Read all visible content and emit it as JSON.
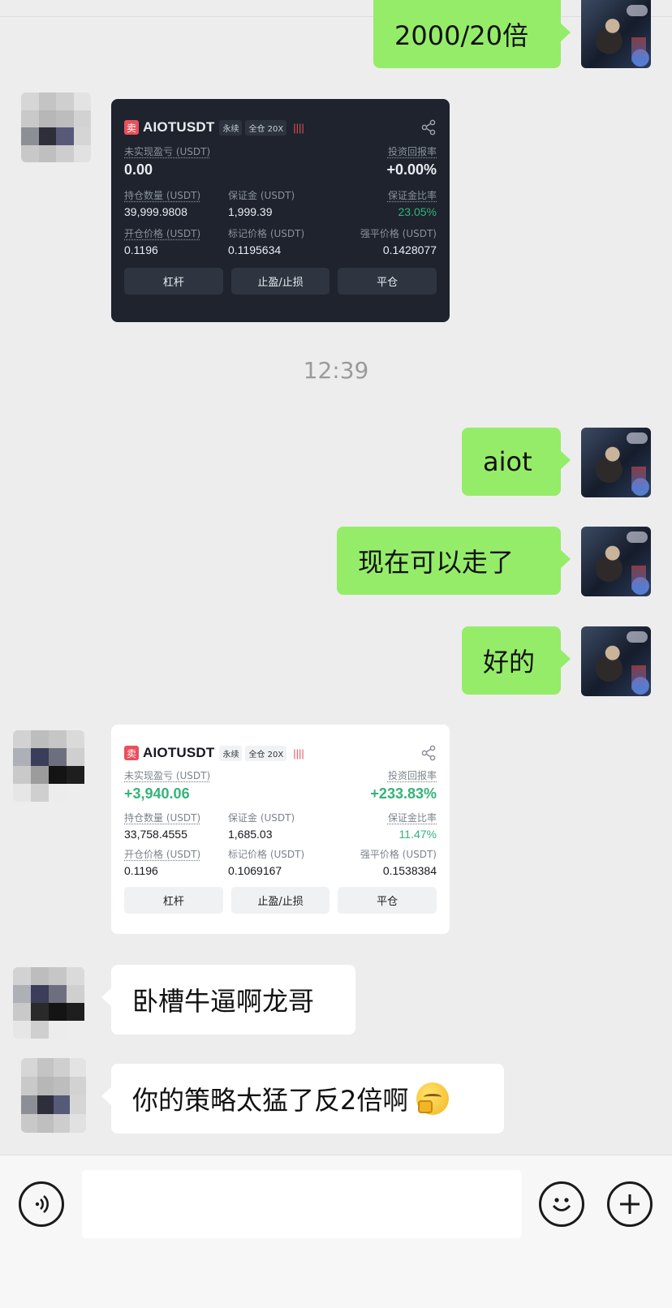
{
  "messages": {
    "m1": "2000/20倍",
    "timestamp": "12:39",
    "m2": "aiot",
    "m3": "现在可以走了",
    "m4": "好的",
    "m5": "卧槽牛逼啊龙哥",
    "m6": "你的策略太猛了反2倍啊"
  },
  "card1": {
    "side_badge": "卖",
    "symbol": "AIOTUSDT",
    "tag_perp": "永续",
    "tag_margin": "全仓 20X",
    "bars": "||||",
    "unrealized_label": "未实现盈亏 (USDT)",
    "unrealized_value": "0.00",
    "roi_label": "投资回报率",
    "roi_value": "+0.00%",
    "size_label": "持仓数量 (USDT)",
    "size_value": "39,999.9808",
    "margin_label": "保证金 (USDT)",
    "margin_value": "1,999.39",
    "margin_ratio_label": "保证金比率",
    "margin_ratio_value": "23.05%",
    "entry_label": "开仓价格 (USDT)",
    "entry_value": "0.1196",
    "mark_label": "标记价格 (USDT)",
    "mark_value": "0.1195634",
    "liq_label": "强平价格 (USDT)",
    "liq_value": "0.1428077",
    "btn_leverage": "杠杆",
    "btn_tpsl": "止盈/止损",
    "btn_close": "平仓"
  },
  "card2": {
    "side_badge": "卖",
    "symbol": "AIOTUSDT",
    "tag_perp": "永续",
    "tag_margin": "全仓 20X",
    "bars": "||||",
    "unrealized_label": "未实现盈亏 (USDT)",
    "unrealized_value": "+3,940.06",
    "roi_label": "投资回报率",
    "roi_value": "+233.83%",
    "size_label": "持仓数量 (USDT)",
    "size_value": "33,758.4555",
    "margin_label": "保证金 (USDT)",
    "margin_value": "1,685.03",
    "margin_ratio_label": "保证金比率",
    "margin_ratio_value": "11.47%",
    "entry_label": "开仓价格 (USDT)",
    "entry_value": "0.1196",
    "mark_label": "标记价格 (USDT)",
    "mark_value": "0.1069167",
    "liq_label": "强平价格 (USDT)",
    "liq_value": "0.1538384",
    "btn_leverage": "杠杆",
    "btn_tpsl": "止盈/止损",
    "btn_close": "平仓"
  },
  "input_bar": {
    "voice_icon": "voice-icon",
    "emoji_icon": "emoji-icon",
    "plus_icon": "plus-icon"
  },
  "colors": {
    "chat_bg": "#ededed",
    "bubble_self": "#95ec69",
    "bubble_other": "#ffffff",
    "profit_green": "#34b37a",
    "sell_red": "#e8505b"
  }
}
